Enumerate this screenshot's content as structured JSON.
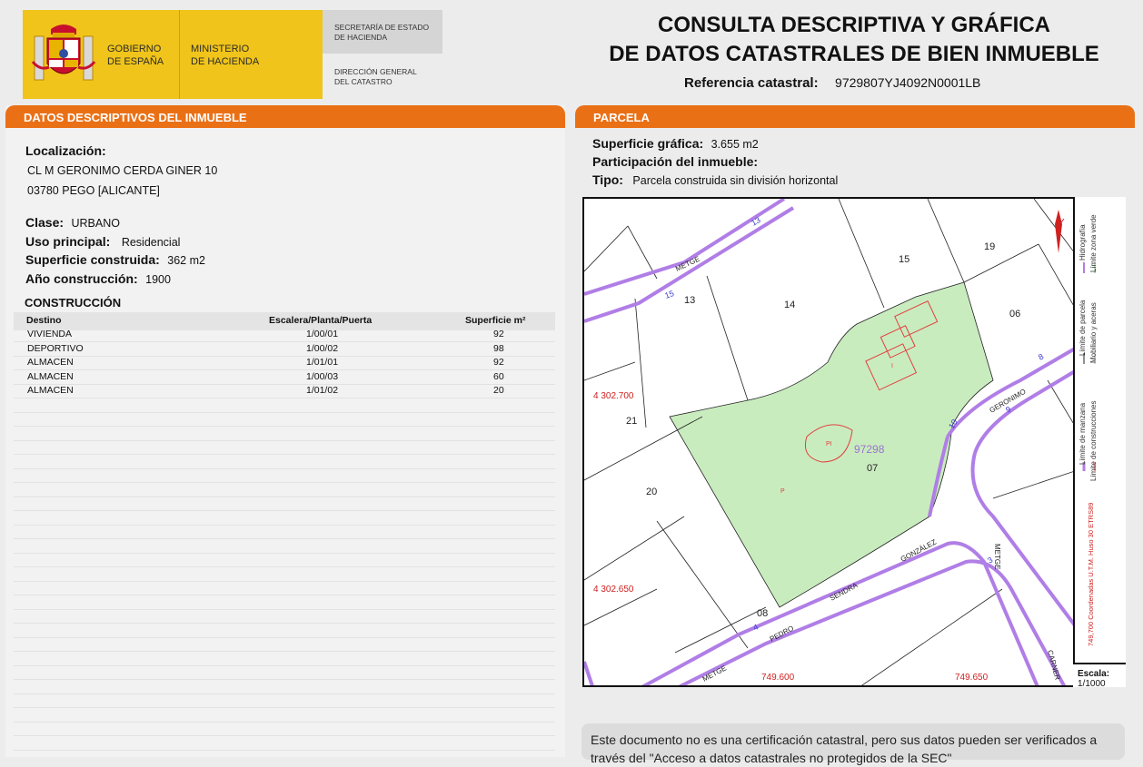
{
  "header": {
    "gov_line1": "GOBIERNO",
    "gov_line2": "DE ESPAÑA",
    "min_line1": "MINISTERIO",
    "min_line2": "DE HACIENDA",
    "sec_line1": "SECRETARÍA DE ESTADO",
    "sec_line2": "DE HACIENDA",
    "dir_line1": "DIRECCIÓN GENERAL",
    "dir_line2": "DEL CATASTRO",
    "title_line1": "CONSULTA DESCRIPTIVA Y GRÁFICA",
    "title_line2": "DE DATOS CATASTRALES DE BIEN INMUEBLE",
    "ref_label": "Referencia catastral:",
    "ref_value": "9729807YJ4092N0001LB"
  },
  "descriptivos": {
    "section_title": "DATOS DESCRIPTIVOS DEL INMUEBLE",
    "localizacion_label": "Localización:",
    "address_line1": "CL M GERONIMO CERDA GINER 10",
    "address_line2": "03780 PEGO [ALICANTE]",
    "clase_label": "Clase:",
    "clase_value": "URBANO",
    "uso_label": "Uso principal:",
    "uso_value": "Residencial",
    "superficie_label": "Superficie construida:",
    "superficie_value": "362 m2",
    "anio_label": "Año construcción:",
    "anio_value": "1900",
    "construccion_title": "CONSTRUCCIÓN",
    "table_headers": [
      "Destino",
      "Escalera/Planta/Puerta",
      "Superficie m²"
    ],
    "rows": [
      [
        "VIVIENDA",
        "1/00/01",
        "92"
      ],
      [
        "DEPORTIVO",
        "1/00/02",
        "98"
      ],
      [
        "ALMACEN",
        "1/01/01",
        "92"
      ],
      [
        "ALMACEN",
        "1/00/03",
        "60"
      ],
      [
        "ALMACEN",
        "1/01/02",
        "20"
      ]
    ]
  },
  "parcela": {
    "section_title": "PARCELA",
    "superficie_label": "Superficie gráfica:",
    "superficie_value": "3.655 m2",
    "participacion_label": "Participación del inmueble:",
    "tipo_label": "Tipo:",
    "tipo_value": "Parcela construida sin división horizontal"
  },
  "map": {
    "parcel_ref": "97298",
    "parcel_numbers": [
      "13",
      "14",
      "15",
      "19",
      "06",
      "21",
      "07",
      "20",
      "08"
    ],
    "street_numbers": [
      "13",
      "15",
      "10",
      "9",
      "8",
      "3",
      "4"
    ],
    "coord_y1": "4 302.700",
    "coord_y2": "4 302.650",
    "coord_x1": "749.600",
    "coord_x2": "749.650",
    "street_metge_top": "METGE",
    "street_geronimo": "GERONIMO",
    "street_gonzalez": "GONZÁLEZ",
    "street_sendra": "SENDRA",
    "street_pedro": "PEDRO",
    "street_metge_bottom": "METGE",
    "street_metge_right": "METGE",
    "street_carner": "CARNER",
    "label_p": "P",
    "label_pi": "PI",
    "label_i": "I",
    "colors": {
      "parcel_fill": "#c9ecbf",
      "street_line": "#b07ee6",
      "construction_line": "#e04040",
      "coord_text": "#d02020",
      "ref_text": "#9b72d0"
    }
  },
  "legend": {
    "items": [
      "Límite de manzana",
      "Límite de parcela",
      "Hidrografía",
      "Límite de construcciones",
      "Mobiliario y aceras",
      "Límite zona verde"
    ],
    "coords_note": "749,700 Coordenadas U.T.M. Huso 30 ETRS89",
    "escala_label": "Escala:",
    "escala_value": "1/1000"
  },
  "footnote": {
    "text": "Este documento no es una certificación catastral, pero sus datos pueden ser verificados a través del \"Acceso a datos catastrales no protegidos de la SEC\""
  }
}
